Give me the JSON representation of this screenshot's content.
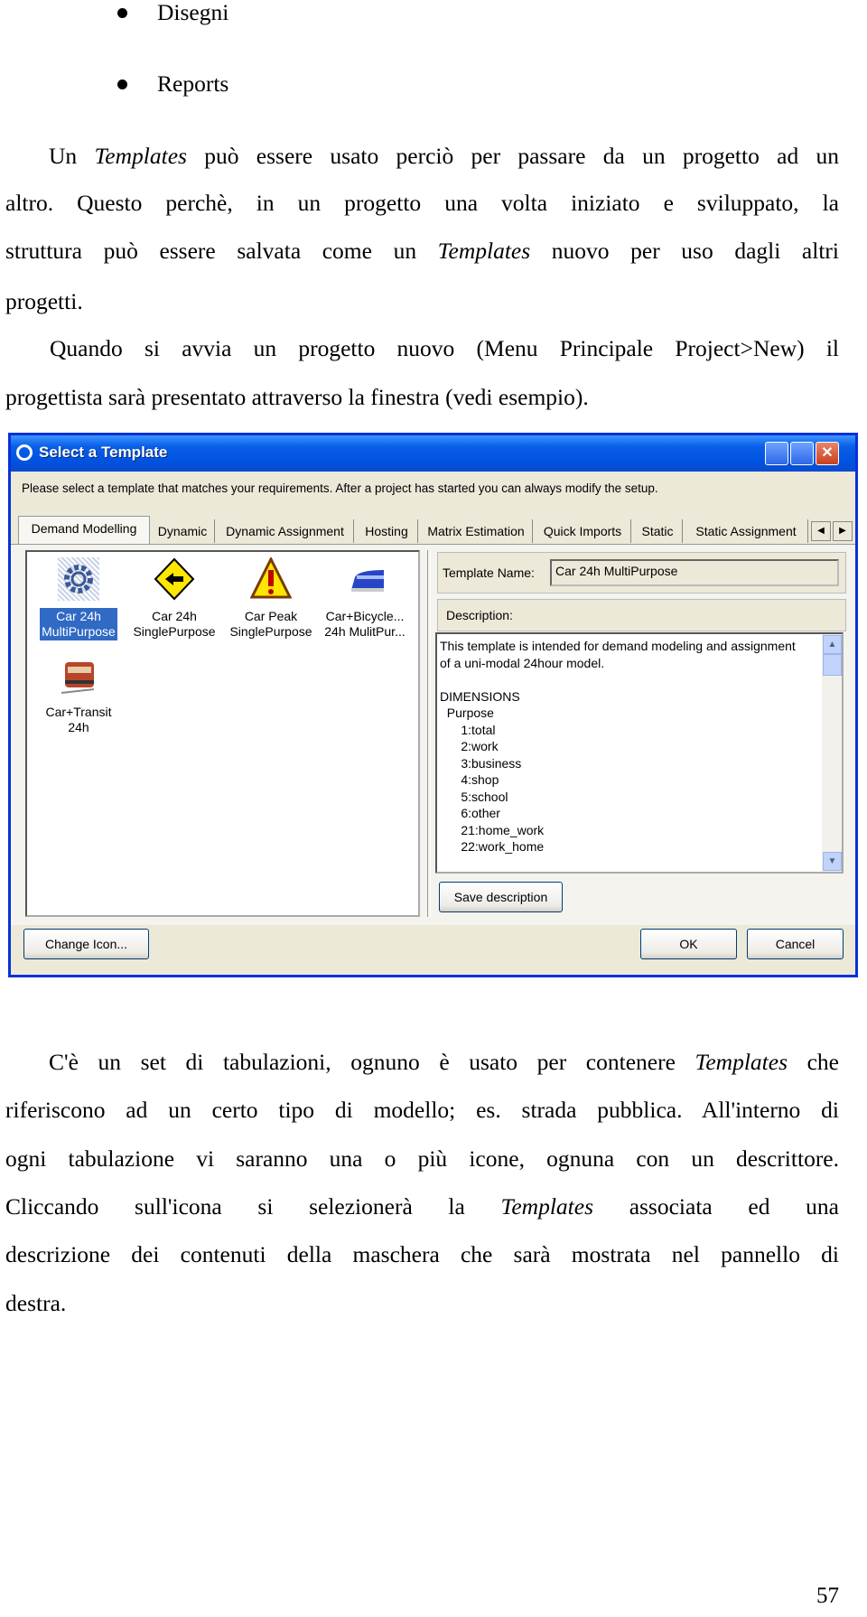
{
  "bullets": [
    "Disegni",
    "Reports"
  ],
  "para1": {
    "l1": [
      "Un ",
      "Templates",
      " può essere usato perciò per passare da un progetto ad un"
    ],
    "l2": "altro. Questo perchè, in un progetto una volta iniziato e sviluppato, la",
    "l3": [
      "struttura può essere salvata come un ",
      "Templates",
      " nuovo per uso dagli altri"
    ],
    "l4": "progetti."
  },
  "para2": {
    "l1": "Quando si avvia un progetto nuovo (Menu Principale Project>New) il",
    "l2": "progettista sarà presentato attraverso la finestra (vedi esempio)."
  },
  "dialog": {
    "title": "Select a Template",
    "instruction": "Please select a template that matches your requirements. After a project has started you can always modify the setup.",
    "tabs": [
      "Demand Modelling",
      "Dynamic",
      "Dynamic Assignment",
      "Hosting",
      "Matrix Estimation",
      "Quick Imports",
      "Static",
      "Static Assignment"
    ],
    "active_tab": "Demand Modelling",
    "templates": [
      {
        "l1": "Car 24h",
        "l2": "MultiPurpose",
        "icon": "gear-icon",
        "selected": true
      },
      {
        "l1": "Car 24h",
        "l2": "SinglePurpose",
        "icon": "road-sign-arrow-icon"
      },
      {
        "l1": "Car Peak",
        "l2": "SinglePurpose",
        "icon": "warning-sign-icon"
      },
      {
        "l1": "Car+Bicycle...",
        "l2": "24h MulitPur...",
        "icon": "train-icon"
      },
      {
        "l1": "Car+Transit",
        "l2": "24h",
        "icon": "locomotive-icon"
      }
    ],
    "template_name_label": "Template Name:",
    "template_name_value": "Car 24h MultiPurpose",
    "description_label": "Description:",
    "description_lines": [
      "This template is intended for demand modeling and assignment",
      "of a uni-modal 24hour model.",
      "",
      "DIMENSIONS",
      "  Purpose",
      "      1:total",
      "      2:work",
      "      3:business",
      "      4:shop",
      "      5:school",
      "      6:other",
      "      21:home_work",
      "      22:work_home"
    ],
    "save_description": "Save description",
    "change_icon": "Change Icon...",
    "ok": "OK",
    "cancel": "Cancel",
    "colors": {
      "titlebar": "#0053E0",
      "selection": "#316AC5",
      "face": "#ECE9D8"
    }
  },
  "para3": {
    "l1": [
      "C'è un set di tabulazioni, ognuno è usato per contenere ",
      "Templates",
      " che"
    ],
    "l2": "riferiscono ad un certo tipo di modello; es. strada pubblica. All'interno di",
    "l3": "ogni tabulazione vi saranno una o più icone, ognuna con un descrittore.",
    "l4": [
      "Cliccando sull'icona si selezionerà la ",
      "Templates",
      " associata ed una"
    ],
    "l5": "descrizione dei contenuti della maschera che sarà mostrata nel pannello di",
    "l6": "destra."
  },
  "page_number": "57"
}
